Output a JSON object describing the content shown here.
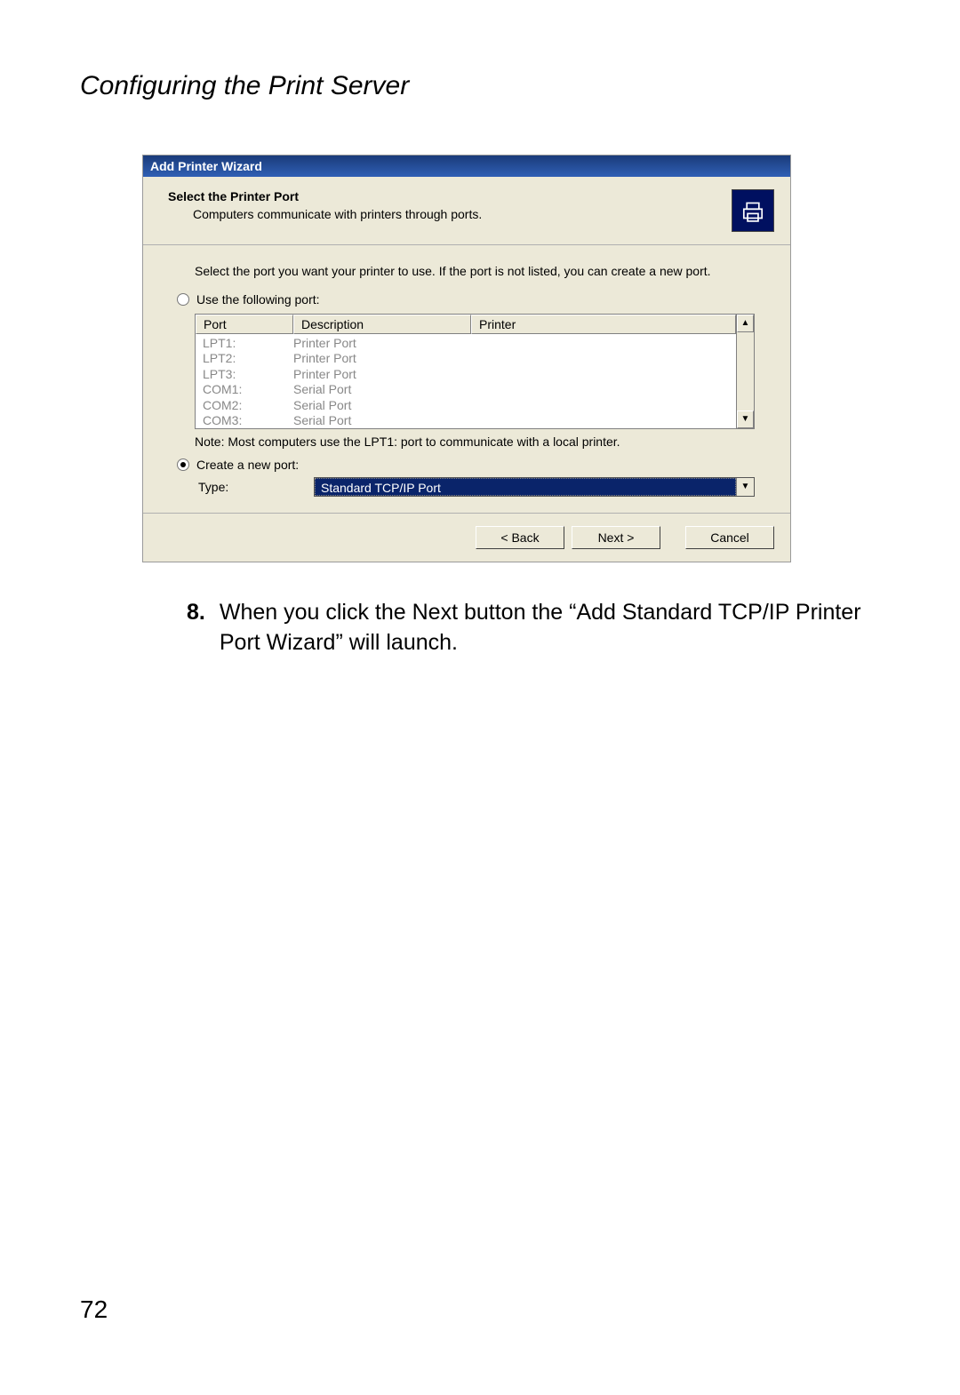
{
  "page": {
    "heading": "Configuring the Print Server",
    "number": "72"
  },
  "wizard": {
    "titlebar": "Add Printer Wizard",
    "header": {
      "title": "Select the Printer Port",
      "subtitle": "Computers communicate with printers through ports."
    },
    "body": {
      "intro": "Select the port you want your printer to use.  If the port is not listed, you can create a new port.",
      "radio_use_label": "Use the following port:",
      "radio_create_label": "Create a new port:",
      "table": {
        "headers": {
          "port": "Port",
          "description": "Description",
          "printer": "Printer"
        },
        "rows": [
          {
            "port": "LPT1:",
            "desc": "Printer Port"
          },
          {
            "port": "LPT2:",
            "desc": "Printer Port"
          },
          {
            "port": "LPT3:",
            "desc": "Printer Port"
          },
          {
            "port": "COM1:",
            "desc": "Serial Port"
          },
          {
            "port": "COM2:",
            "desc": "Serial Port"
          },
          {
            "port": "COM3:",
            "desc": "Serial Port"
          }
        ]
      },
      "note": "Note: Most computers use the LPT1: port to communicate with a local printer.",
      "type_label": "Type:",
      "type_value": "Standard TCP/IP Port"
    },
    "buttons": {
      "back": "< Back",
      "next": "Next >",
      "cancel": "Cancel"
    }
  },
  "step": {
    "number": "8.",
    "text": "When you click the Next button the “Add Standard TCP/IP Printer Port Wizard” will launch."
  }
}
